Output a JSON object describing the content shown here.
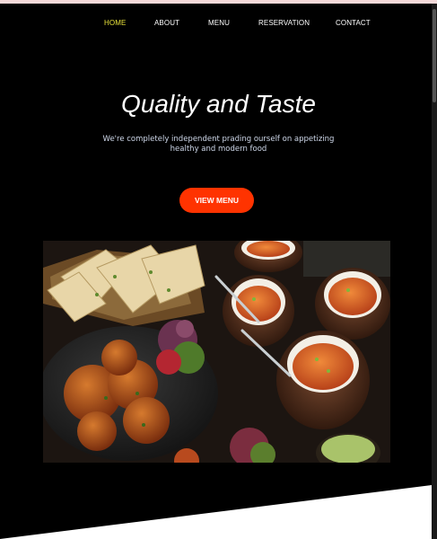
{
  "nav": {
    "items": [
      {
        "label": "HOME",
        "active": true
      },
      {
        "label": "ABOUT",
        "active": false
      },
      {
        "label": "MENU",
        "active": false
      },
      {
        "label": "RESERVATION",
        "active": false
      },
      {
        "label": "CONTACT",
        "active": false
      }
    ],
    "active_color": "#e8e23a"
  },
  "hero": {
    "title": "Quality and Taste",
    "subtitle_line1": "We're completely independent prading ourself on appetizing",
    "subtitle_line2": "healthy and modern food",
    "button_label": "VIEW MENU",
    "button_color": "#ff3300"
  },
  "image": {
    "subject": "indian-food-platter"
  }
}
